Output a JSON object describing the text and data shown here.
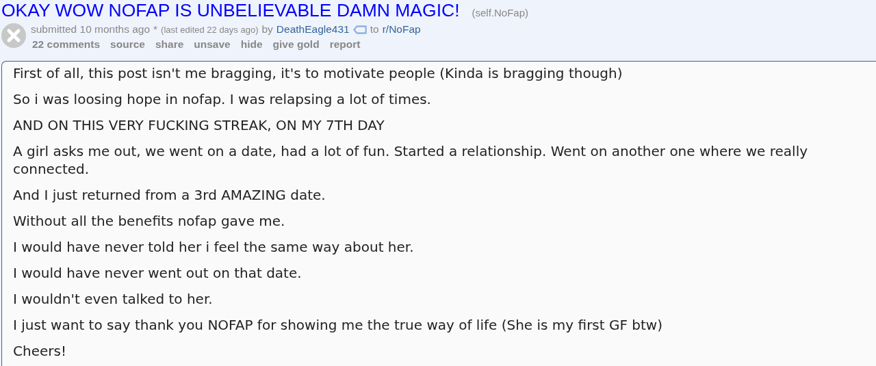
{
  "post": {
    "title": "OKAY WOW NOFAP IS UNBELIEVABLE DAMN MAGIC!",
    "domain": "(self.NoFap)",
    "submitted": "submitted 10 months ago",
    "edited_mark": "*",
    "edited": "(last edited 22 days ago)",
    "by": "by",
    "author": "DeathEagle431",
    "to": "to",
    "subreddit": "r/NoFap",
    "actions": [
      "22 comments",
      "source",
      "share",
      "unsave",
      "hide",
      "give gold",
      "report"
    ],
    "paragraphs": [
      "First of all, this post isn't me bragging, it's to motivate people (Kinda is bragging though)",
      "So i was loosing hope in nofap. I was relapsing a lot of times.",
      "AND ON THIS VERY FUCKING STREAK, ON MY 7TH DAY",
      "A girl asks me out, we went on a date, had a lot of fun. Started a relationship. Went on another one where we really connected.",
      "And I just returned from a 3rd AMAZING date.",
      "Without all the benefits nofap gave me.",
      "I would have never told her i feel the same way about her.",
      "I would have never went out on that date.",
      "I wouldn't even talked to her.",
      "I just want to say thank you NOFAP for showing me the true way of life (She is my first GF btw)",
      "Cheers!"
    ]
  }
}
